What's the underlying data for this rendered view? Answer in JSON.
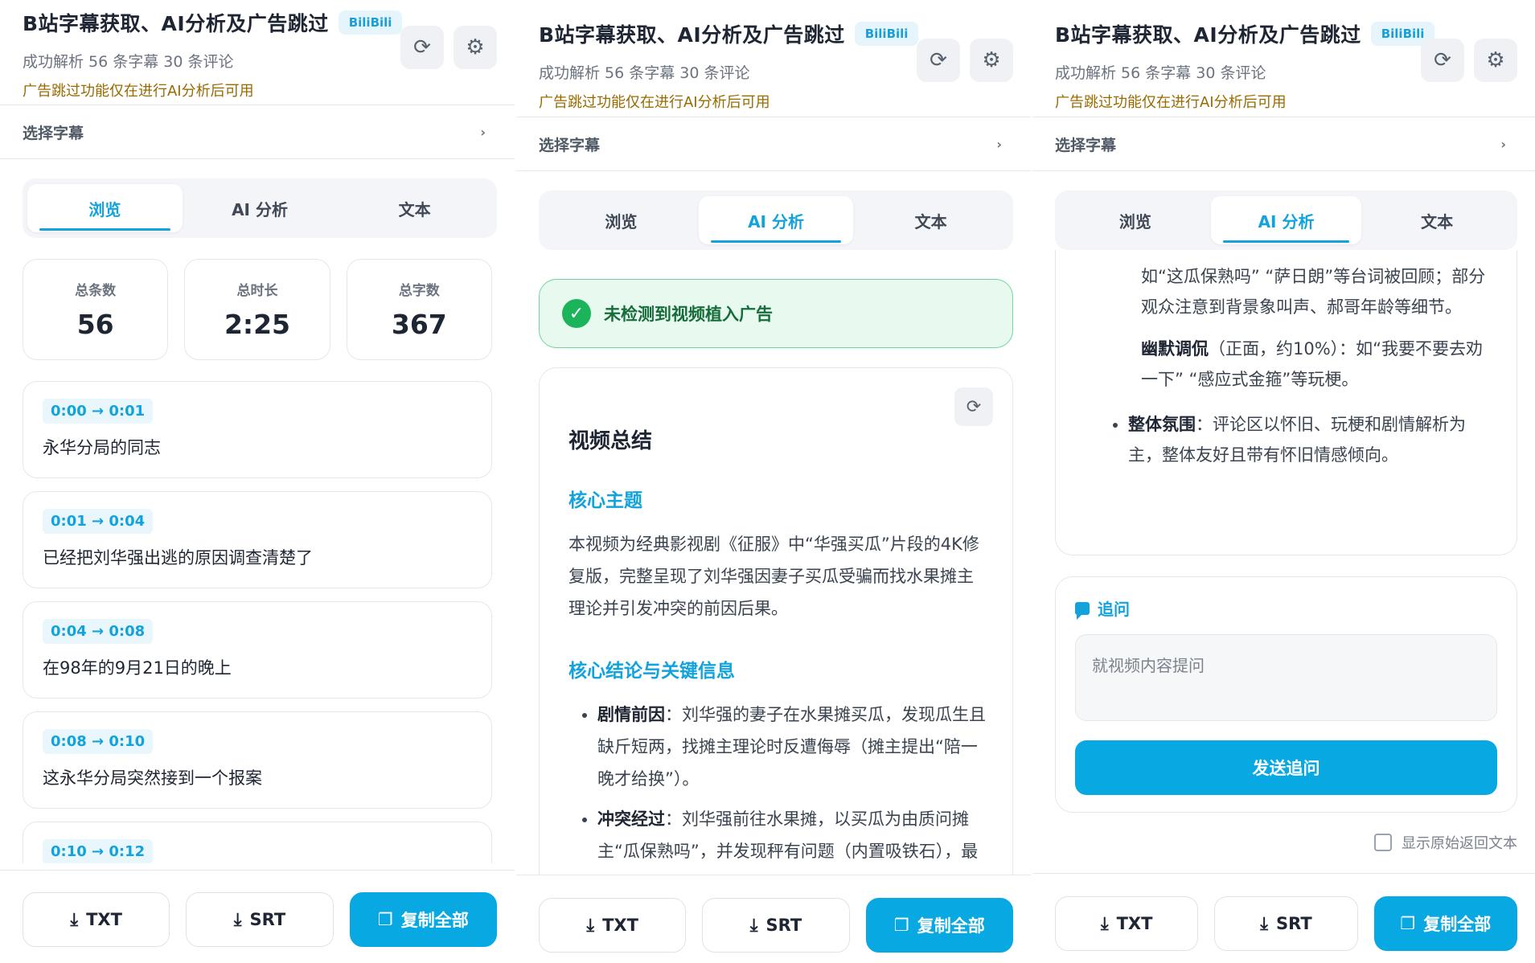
{
  "header": {
    "title": "B站字幕获取、AI分析及广告跳过",
    "badge": "BiliBili",
    "subtitle": "成功解析 56 条字幕 30 条评论",
    "warning": "广告跳过功能仅在进行AI分析后可用",
    "refresh_icon": "refresh-icon",
    "settings_icon": "gear-icon"
  },
  "selector": {
    "label": "选择字幕",
    "chevron": "›"
  },
  "tabs": [
    {
      "label": "浏览"
    },
    {
      "label": "AI 分析"
    },
    {
      "label": "文本"
    }
  ],
  "stats": [
    {
      "label": "总条数",
      "value": "56"
    },
    {
      "label": "总时长",
      "value": "2:25"
    },
    {
      "label": "总字数",
      "value": "367"
    }
  ],
  "subtitles": [
    {
      "time": "0:00 → 0:01",
      "text": "永华分局的同志"
    },
    {
      "time": "0:01 → 0:04",
      "text": "已经把刘华强出逃的原因调查清楚了"
    },
    {
      "time": "0:04 → 0:08",
      "text": "在98年的9月21日的晚上"
    },
    {
      "time": "0:08 → 0:10",
      "text": "这永华分局突然接到一个报案"
    },
    {
      "time": "0:10 → 0:12",
      "text": ""
    }
  ],
  "footer": {
    "txt_label": "TXT",
    "srt_label": "SRT",
    "copy_label": "复制全部"
  },
  "ai": {
    "ad_status": "未检测到视频植入广告",
    "summary_title": "视频总结",
    "section1_title": "核心主题",
    "section1_text": "本视频为经典影视剧《征服》中“华强买瓜”片段的4K修复版，完整呈现了刘华强因妻子买瓜受骗而找水果摊主理论并引发冲突的前因后果。",
    "section2_title": "核心结论与关键信息",
    "bullets": [
      {
        "key": "剧情前因",
        "text": "：刘华强的妻子在水果摊买瓜，发现瓜生且缺斤短两，找摊主理论时反遭侮辱（摊主提出“陪一晚才给换”）。"
      },
      {
        "key": "冲突经过",
        "text": "：刘华强前往水果摊，以买瓜为由质问摊主“瓜保熟吗”，并发现秤有问题（内置吸铁石），最终摊主挑衅后刘华强持刀伤人。"
      }
    ]
  },
  "ai2": {
    "line_a": "如“这瓜保熟吗” “萨日朗”等台词被回顾；部分观众注意到背景象叫声、郝哥年龄等细节。",
    "humor_key": "幽默调侃",
    "humor_text": "（正面，约10%）：如“我要不要去劝一下” “感应式金箍”等玩梗。",
    "overall_key": "整体氛围",
    "overall_text": "：评论区以怀旧、玩梗和剧情解析为主，整体友好且带有怀旧情感倾向。"
  },
  "followup": {
    "title": "追问",
    "placeholder": "就视频内容提问",
    "send_label": "发送追问",
    "raw_label": "显示原始返回文本"
  }
}
